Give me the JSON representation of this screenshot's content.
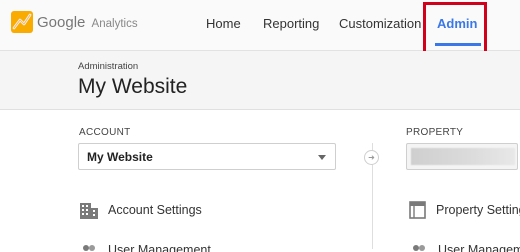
{
  "brand": {
    "google": "Google",
    "product": "Analytics"
  },
  "nav": {
    "items": [
      {
        "label": "Home"
      },
      {
        "label": "Reporting"
      },
      {
        "label": "Customization"
      },
      {
        "label": "Admin",
        "active": true
      }
    ]
  },
  "header": {
    "section": "Administration",
    "title": "My Website"
  },
  "account": {
    "column_label": "ACCOUNT",
    "selected": "My Website",
    "settings_label": "Account Settings",
    "next_item_label": "User Management"
  },
  "property": {
    "column_label": "PROPERTY",
    "settings_label": "Property Settings",
    "next_item_label": "User Management"
  },
  "colors": {
    "accent": "#3b78e7",
    "highlight": "#d0021b",
    "logo_orange": "#e8710a",
    "logo_yellow": "#f9ab00"
  },
  "icons": {
    "logo": "google-analytics-logo",
    "dropdown": "chevron-down-icon",
    "arrow": "arrow-right-icon",
    "account_settings": "building-icon",
    "property_settings": "document-icon",
    "user_management": "users-icon"
  }
}
